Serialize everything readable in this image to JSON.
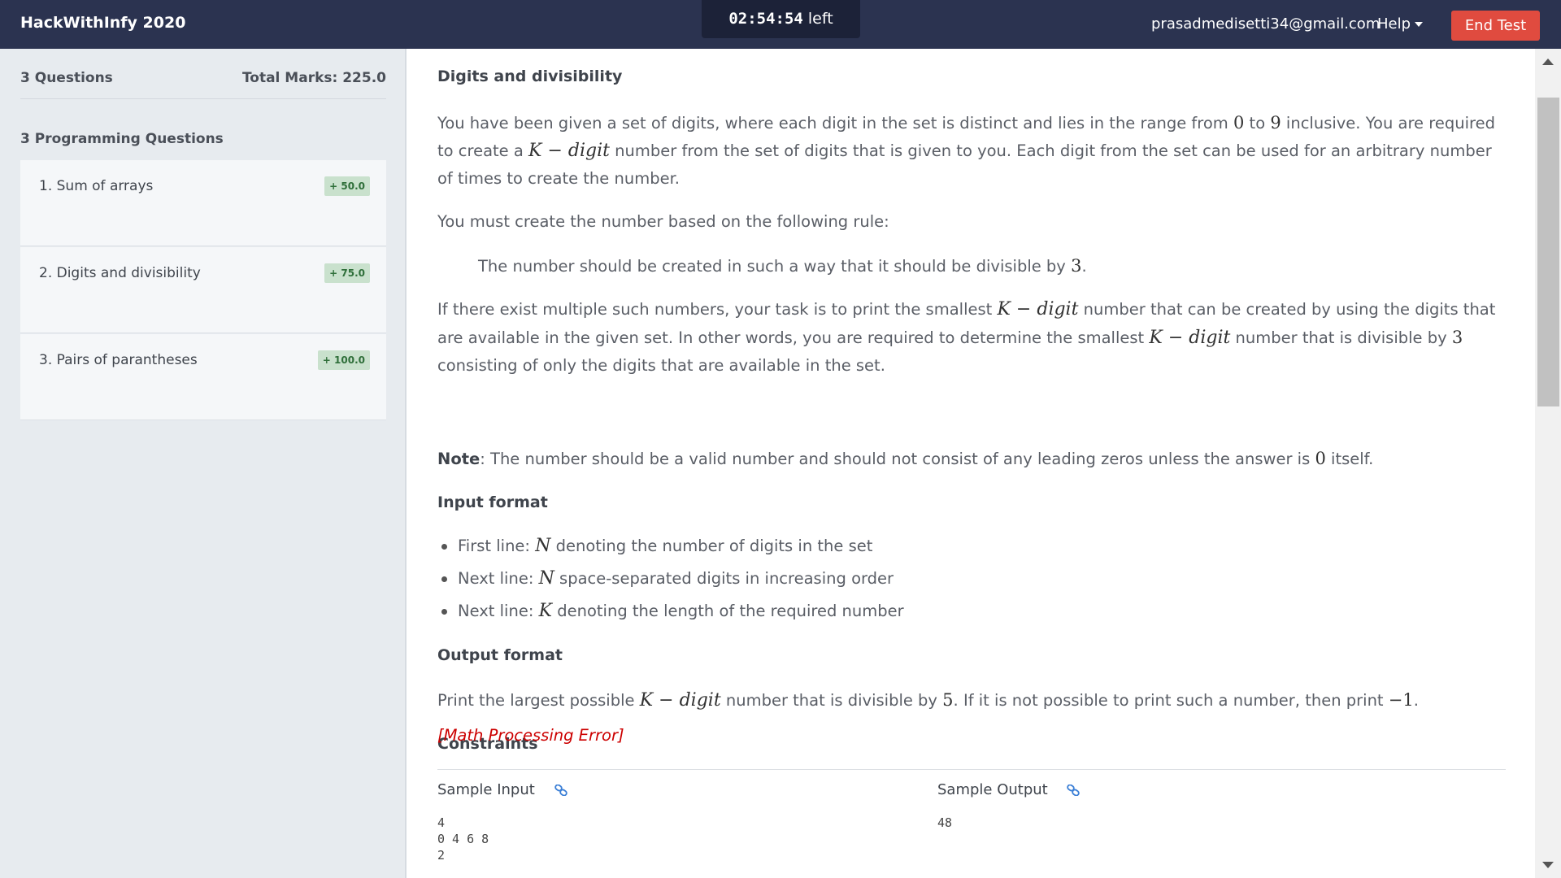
{
  "header": {
    "brand": "HackWithInfy 2020",
    "timer_value": "02:54:54",
    "timer_suffix": "left",
    "email": "prasadmedisetti34@gmail.com",
    "help_label": "Help",
    "end_test_label": "End Test"
  },
  "sidebar": {
    "question_count": "3 Questions",
    "total_marks": "Total Marks: 225.0",
    "section_title": "3 Programming Questions",
    "questions": [
      {
        "title": "1. Sum of arrays",
        "marks": "+ 50.0"
      },
      {
        "title": "2. Digits and divisibility",
        "marks": "+ 75.0"
      },
      {
        "title": "3. Pairs of parantheses",
        "marks": "+ 100.0"
      }
    ]
  },
  "problem": {
    "title": "Digits and divisibility",
    "intro": {
      "t1": "You have been given a set of digits, where each digit in the set is distinct and lies in the range from ",
      "m1": "0",
      "t2": " to ",
      "m2": "9",
      "t3": " inclusive. You are required to create a ",
      "m3": "K − digit",
      "t4": " number from the set of digits that is given to you. Each digit from the set can be used for an arbitrary number of times to create the number."
    },
    "rule_intro": "You must create the number based on the following rule:",
    "rule": {
      "t1": "The number should be created in such a way that it should be divisible by ",
      "m1": "3",
      "t2": "."
    },
    "task": {
      "t1": "If there exist multiple such numbers, your task is to print the smallest ",
      "m1": "K − digit",
      "t2": " number that can be created by using the digits that are available in the given set. In other words, you are required to determine the smallest ",
      "m2": "K − digit",
      "t3": " number that is divisible by ",
      "m3": "3",
      "t4": " consisting of only the digits that are available in the set."
    },
    "note": {
      "label": "Note",
      "t1": ": The number should be a valid number and should not consist of any leading zeros unless the answer is ",
      "m1": "0",
      "t2": " itself."
    },
    "input_format_heading": "Input format",
    "input_format": [
      {
        "pre": "First line: ",
        "math": "N",
        "post": " denoting the number of digits in the set"
      },
      {
        "pre": "Next line: ",
        "math": "N",
        "post": " space-separated digits in increasing order"
      },
      {
        "pre": "Next line: ",
        "math": "K",
        "post": " denoting the length of the required number"
      }
    ],
    "output_format_heading": "Output format",
    "output": {
      "t1": "Print the largest possible ",
      "m1": "K − digit",
      "t2": " number that is divisible by ",
      "m2": "5",
      "t3": ". If it is not possible to print such a number, then print ",
      "m3": "−1",
      "t4": "."
    },
    "constraints_heading": "Constraints",
    "constraints_error": "[Math Processing Error]",
    "sample_input_label": "Sample Input",
    "sample_output_label": "Sample Output",
    "sample_input_lines": [
      "4",
      "0 4 6 8",
      "2"
    ],
    "sample_output_lines": [
      "48"
    ]
  },
  "colors": {
    "header_bg": "#2b3350",
    "end_test_bg": "#e04b3f",
    "sidebar_bg": "#e7ebef",
    "badge_bg": "#c9e1cd",
    "error_text": "#cc0000",
    "link_icon": "#3b7fd6"
  },
  "icons": {
    "help_caret": "chevron-down-icon",
    "sample_link": "link-icon"
  }
}
